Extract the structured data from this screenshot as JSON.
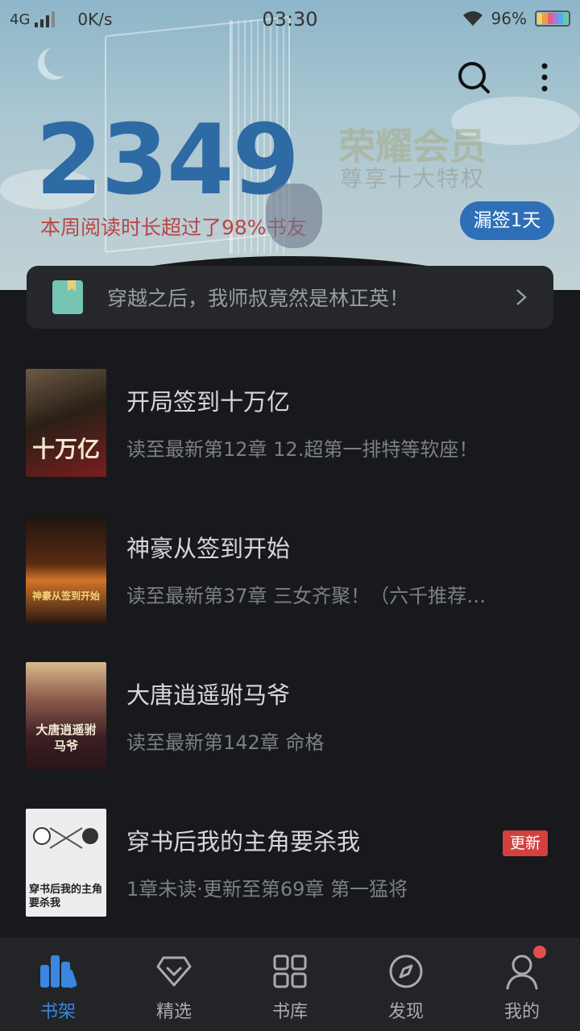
{
  "status_bar": {
    "network": "4G",
    "speed": "0K/s",
    "time": "03:30",
    "battery": "96%"
  },
  "header": {
    "reading_minutes": "2349",
    "reading_note": "本周阅读时长超过了98%书友",
    "vip_title": "荣耀会员",
    "vip_subtitle": "尊享十大特权",
    "checkin_label": "漏签1天"
  },
  "recommend": {
    "text": "穿越之后，我师叔竟然是林正英！"
  },
  "books": [
    {
      "title": "开局签到十万亿",
      "progress": "读至最新第12章 12.超第一排特等软座！",
      "badge": "",
      "cover_text": "十万亿",
      "cover_colors": [
        "#3a2a1c",
        "#7a1e1e"
      ]
    },
    {
      "title": "神豪从签到开始",
      "progress": "读至最新第37章 三女齐聚！（六千推荐…",
      "badge": "",
      "cover_text": "神豪从签到开始",
      "cover_colors": [
        "#1d1410",
        "#b5571d"
      ]
    },
    {
      "title": "大唐逍遥驸马爷",
      "progress": "读至最新第142章 命格",
      "badge": "",
      "cover_text": "大唐逍遥驸马爷",
      "cover_colors": [
        "#c9a57a",
        "#3b1f24"
      ]
    },
    {
      "title": "穿书后我的主角要杀我",
      "progress": "1章未读·更新至第69章 第一猛将",
      "badge": "更新",
      "cover_text": "穿书后我的主角要杀我",
      "cover_colors": [
        "#f2f2f2",
        "#d8d8d8"
      ]
    }
  ],
  "nav": {
    "items": [
      {
        "label": "书架",
        "icon": "bookshelf-icon",
        "active": true
      },
      {
        "label": "精选",
        "icon": "diamond-icon",
        "active": false
      },
      {
        "label": "书库",
        "icon": "grid-icon",
        "active": false
      },
      {
        "label": "发现",
        "icon": "compass-icon",
        "active": false
      },
      {
        "label": "我的",
        "icon": "profile-icon",
        "active": false
      }
    ]
  },
  "colors": {
    "accent": "#3a86e0",
    "badge": "#d24040",
    "background": "#18191c"
  }
}
